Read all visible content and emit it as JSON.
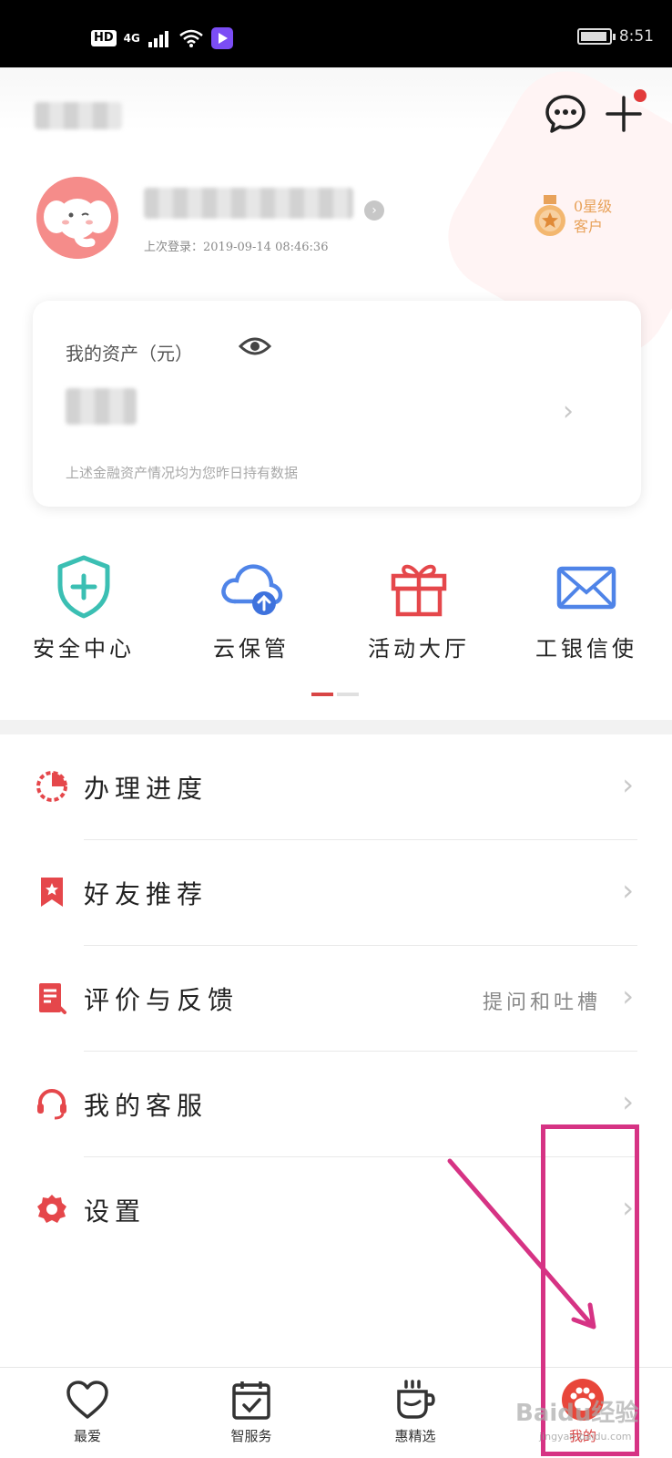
{
  "status_bar": {
    "hd": "HD",
    "network": "4G",
    "time": "8:51"
  },
  "profile": {
    "last_login": "上次登录：2019-09-14 08:46:36",
    "level_line1": "0星级",
    "level_line2": "客户"
  },
  "assets": {
    "title": "我的资产（元）",
    "note": "上述金融资产情况均为您昨日持有数据"
  },
  "quick_actions": [
    {
      "label": "安全中心",
      "icon": "shield-plus-icon"
    },
    {
      "label": "云保管",
      "icon": "cloud-upload-icon"
    },
    {
      "label": "活动大厅",
      "icon": "gift-icon"
    },
    {
      "label": "工银信使",
      "icon": "mail-icon"
    }
  ],
  "menu": [
    {
      "label": "办理进度",
      "icon": "progress-pie-icon",
      "hint": ""
    },
    {
      "label": "好友推荐",
      "icon": "bookmark-star-icon",
      "hint": ""
    },
    {
      "label": "评价与反馈",
      "icon": "feedback-doc-icon",
      "hint": "提问和吐槽"
    },
    {
      "label": "我的客服",
      "icon": "headset-icon",
      "hint": ""
    },
    {
      "label": "设置",
      "icon": "gear-icon",
      "hint": ""
    }
  ],
  "bottom_nav": [
    {
      "label": "最爱",
      "icon": "heart-icon"
    },
    {
      "label": "智服务",
      "icon": "calendar-check-icon"
    },
    {
      "label": "惠精选",
      "icon": "cup-icon"
    },
    {
      "label": "我的",
      "icon": "mine-paw-icon"
    }
  ],
  "watermark": {
    "main": "Baidu经验",
    "sub": "jingyan.baidu.com"
  },
  "colors": {
    "accent": "#d84545",
    "annotation": "#d63384",
    "gold": "#e8a25a"
  }
}
